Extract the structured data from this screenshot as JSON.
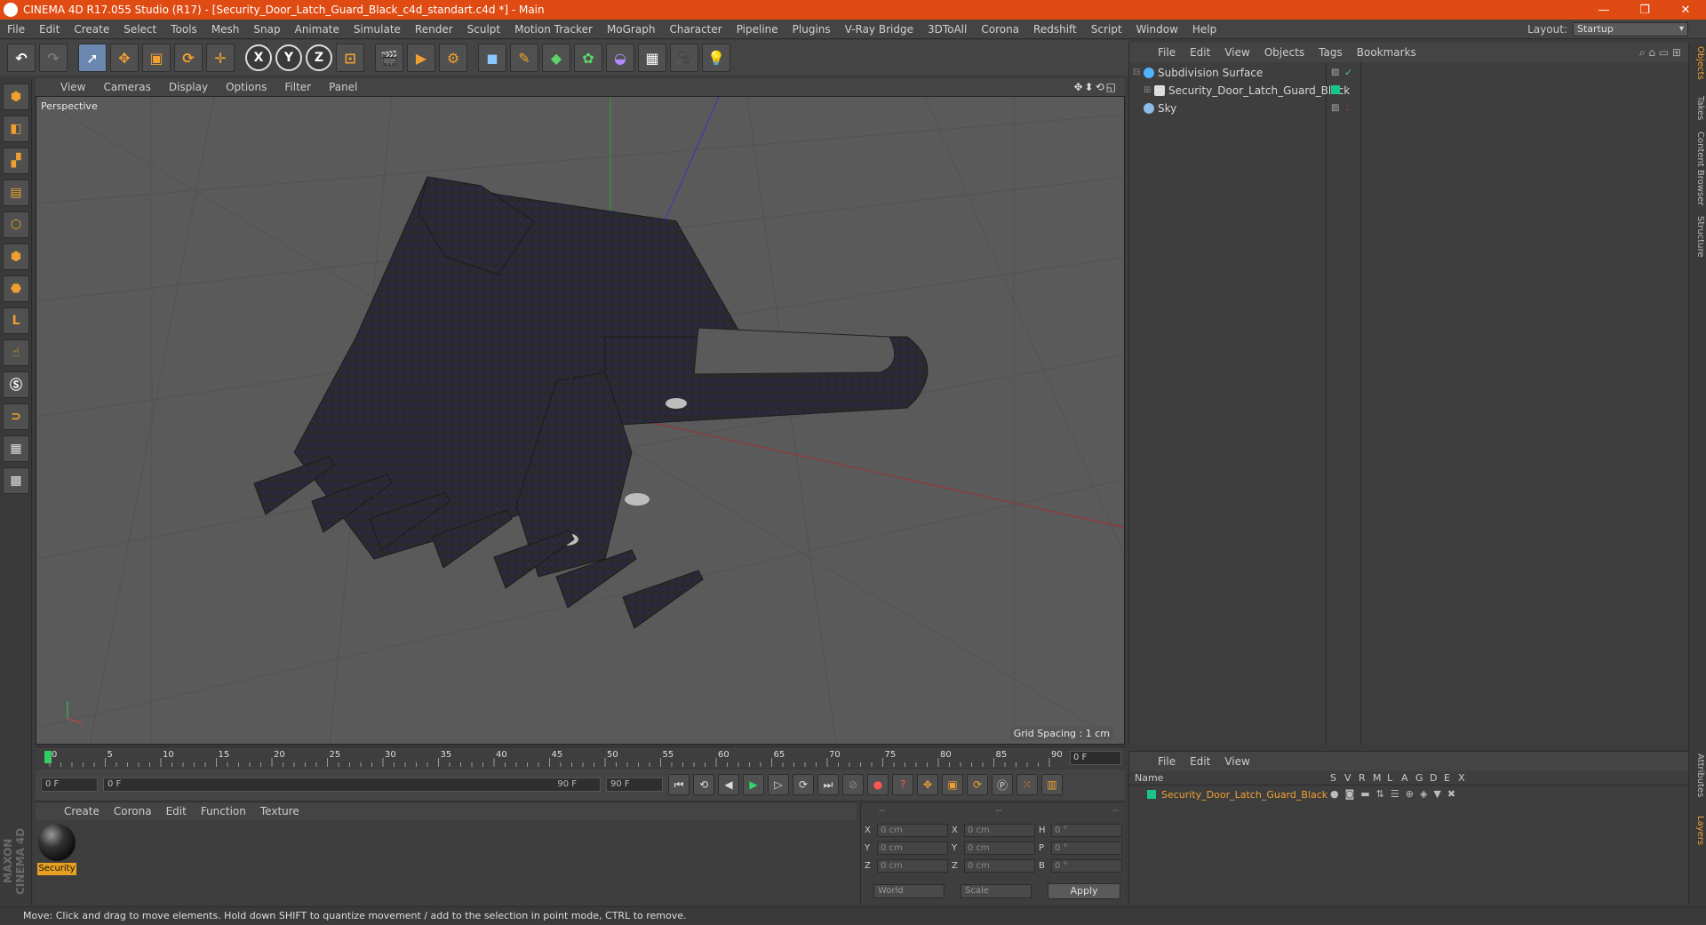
{
  "window": {
    "title": "CINEMA 4D R17.055 Studio (R17) - [Security_Door_Latch_Guard_Black_c4d_standart.c4d *] - Main",
    "controls": [
      "—",
      "❐",
      "✕"
    ]
  },
  "menu": {
    "items": [
      "File",
      "Edit",
      "Create",
      "Select",
      "Tools",
      "Mesh",
      "Snap",
      "Animate",
      "Simulate",
      "Render",
      "Sculpt",
      "Motion Tracker",
      "MoGraph",
      "Character",
      "Pipeline",
      "Plugins",
      "V-Ray Bridge",
      "3DToAll",
      "Corona",
      "Redshift",
      "Script",
      "Window",
      "Help"
    ],
    "layout_label": "Layout:",
    "layout_value": "Startup"
  },
  "viewport": {
    "menu": [
      "View",
      "Cameras",
      "Display",
      "Options",
      "Filter",
      "Panel"
    ],
    "label": "Perspective",
    "grid_spacing": "Grid Spacing : 1 cm",
    "nav_icons": "✥⬍⟲◱"
  },
  "timeline": {
    "ticks": [
      "0",
      "5",
      "10",
      "15",
      "20",
      "25",
      "30",
      "35",
      "40",
      "45",
      "50",
      "55",
      "60",
      "65",
      "70",
      "75",
      "80",
      "85",
      "90"
    ],
    "current_frame": "0 F"
  },
  "playback": {
    "start": "0 F",
    "range_start": "0 F",
    "range_end": "90 F",
    "end": "90 F"
  },
  "material": {
    "menu": [
      "Create",
      "Corona",
      "Edit",
      "Function",
      "Texture"
    ],
    "name": "Security"
  },
  "coords": {
    "header": [
      "--",
      "--",
      "--"
    ],
    "rows": [
      {
        "a": "X",
        "av": "0 cm",
        "b": "X",
        "bv": "0 cm",
        "c": "H",
        "cv": "0 °"
      },
      {
        "a": "Y",
        "av": "0 cm",
        "b": "Y",
        "bv": "0 cm",
        "c": "P",
        "cv": "0 °"
      },
      {
        "a": "Z",
        "av": "0 cm",
        "b": "Z",
        "bv": "0 cm",
        "c": "B",
        "cv": "0 °"
      }
    ],
    "world": "World",
    "scale": "Scale",
    "apply": "Apply"
  },
  "objects": {
    "menu": [
      "File",
      "Edit",
      "View",
      "Objects",
      "Tags",
      "Bookmarks"
    ],
    "items": [
      {
        "name": "Subdivision Surface",
        "color": "#4fb3ff"
      },
      {
        "name": "Security_Door_Latch_Guard_Black",
        "color": "#dddddd"
      },
      {
        "name": "Sky",
        "color": "#8fbbe8"
      }
    ]
  },
  "layers": {
    "menu": [
      "File",
      "Edit",
      "View"
    ],
    "cols": [
      "Name",
      "S",
      "V",
      "R",
      "M",
      "L",
      "A",
      "G",
      "D",
      "E",
      "X"
    ],
    "row": "Security_Door_Latch_Guard_Black"
  },
  "right_tabs": [
    "Objects",
    "Takes",
    "Content Browser",
    "Structure",
    "Attributes",
    "Layers"
  ],
  "status": "Move: Click and drag to move elements. Hold down SHIFT to quantize movement / add to the selection in point mode, CTRL to remove.",
  "brand": "MAXON CINEMA 4D",
  "colors": {
    "title_bar": "#e04b13",
    "accent": "#e8a020",
    "layer_green": "#18c48a"
  }
}
